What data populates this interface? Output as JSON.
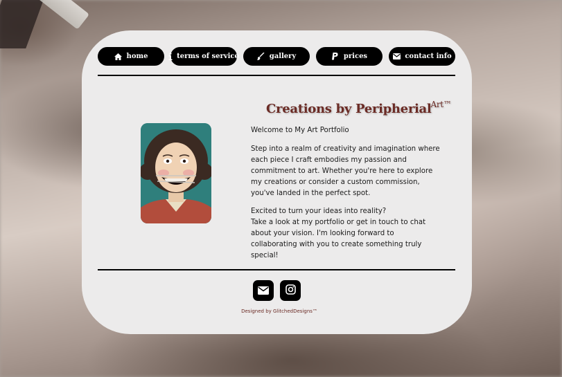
{
  "nav": {
    "items": [
      {
        "label": "home",
        "icon": "home-icon"
      },
      {
        "label": "terms of service",
        "icon": "info-icon"
      },
      {
        "label": "gallery",
        "icon": "paintbrush-icon"
      },
      {
        "label": "prices",
        "icon": "paypal-icon"
      },
      {
        "label": "contact info",
        "icon": "envelope-icon"
      }
    ]
  },
  "header": {
    "title": "Creations by Peripherial",
    "title_sup": "Art™"
  },
  "portrait": {
    "description_icon": "portrait-image"
  },
  "content": {
    "welcome": "Welcome to My Art Portfolio",
    "intro": "Step into a realm of creativity and imagination where each piece I craft embodies my passion and commitment to art. Whether you're here to explore my creations or consider a custom commission, you've landed in the perfect spot.",
    "cta_line1": "Excited to turn your ideas into reality?",
    "cta_line2": "Take a look at my portfolio or get in touch to chat about your vision. I'm looking forward to collaborating with you to create something truly special!"
  },
  "footer": {
    "socials": [
      {
        "icon": "envelope-icon"
      },
      {
        "icon": "instagram-icon"
      }
    ],
    "credit": "Designed by GlitchedDesigns™"
  },
  "colors": {
    "accent": "#6b2b25",
    "card": "#ecebeb",
    "button": "#000000"
  }
}
